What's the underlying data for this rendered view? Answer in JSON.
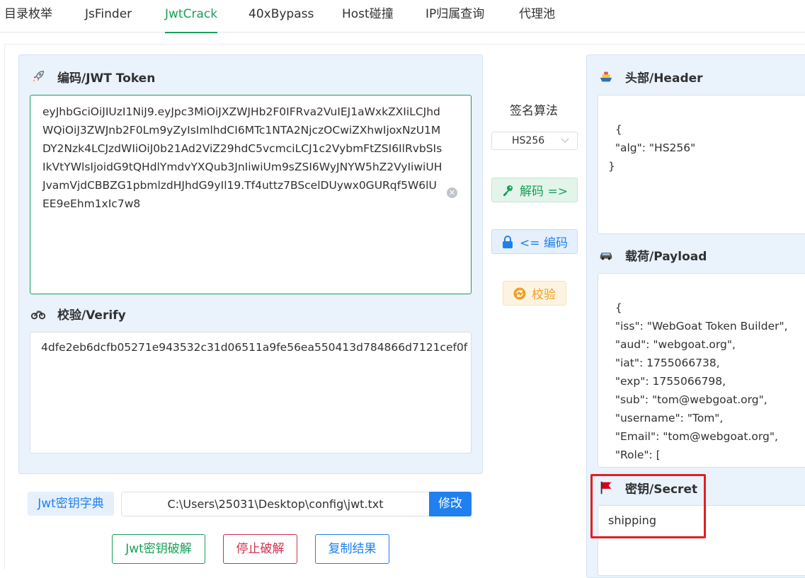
{
  "tabs": [
    {
      "label": "目录枚举"
    },
    {
      "label": "JsFinder"
    },
    {
      "label": "JwtCrack"
    },
    {
      "label": "40xBypass"
    },
    {
      "label": "Host碰撞"
    },
    {
      "label": "IP归属查询"
    },
    {
      "label": "代理池"
    }
  ],
  "active_tab": "JwtCrack",
  "encode_panel": {
    "title": "编码/JWT Token",
    "icon": "rocket-icon",
    "token": "eyJhbGciOiJIUzI1NiJ9.eyJpc3MiOiJXZWJHb2F0IFRva2VuIEJ1aWxkZXIiLCJhdWQiOiJ3ZWJnb2F0Lm9yZyIsImlhdCI6MTc1NTA2NjczOCwiZXhwIjoxNzU1MDY2Nzk4LCJzdWIiOiJ0b21Ad2ViZ29hdC5vcmciLCJ1c2VybmFtZSI6IlRvbSIsIkVtYWlsIjoidG9tQHdlYmdvYXQub3JnIiwiUm9sZSI6WyJNYW5hZ2VyIiwiUHJvamVjdCBBZG1pbmlzdHJhdG9yIl19.Tf4uttz7BScelDUywx0GURqf5W6lUEE9eEhm1xIc7w8"
  },
  "verify_panel": {
    "title": "校验/Verify",
    "icon": "motorcycle-icon",
    "value": "4dfe2eb6dcfb05271e943532c31d06511a9fe56ea550413d784866d7121cef0f"
  },
  "algorithm": {
    "label": "签名算法",
    "selected": "HS256"
  },
  "actions": {
    "decode_label": "解码 =>",
    "encode_label": "<= 编码",
    "verify_label": "校验"
  },
  "header_panel": {
    "title": "头部/Header",
    "icon": "ship-icon",
    "content": "{\n  \"alg\": \"HS256\"\n}"
  },
  "payload_panel": {
    "title": "载荷/Payload",
    "icon": "car-icon",
    "content": "{\n  \"iss\": \"WebGoat Token Builder\",\n  \"aud\": \"webgoat.org\",\n  \"iat\": 1755066738,\n  \"exp\": 1755066798,\n  \"sub\": \"tom@webgoat.org\",\n  \"username\": \"Tom\",\n  \"Email\": \"tom@webgoat.org\",\n  \"Role\": [\n    \"Manager\",\n    \"Project Administrator\"\n  ]\n}"
  },
  "secret_panel": {
    "title": "密钥/Secret",
    "icon": "flag-icon",
    "value": "shipping"
  },
  "dictionary": {
    "tag": "Jwt密钥字典",
    "path": "C:\\Users\\25031\\Desktop\\config\\jwt.txt",
    "modify_label": "修改"
  },
  "bottom_buttons": {
    "crack": "Jwt密钥破解",
    "stop": "停止破解",
    "copy": "复制结果"
  },
  "colors": {
    "green": "#18a058",
    "blue": "#2080f0",
    "orange": "#f0a020",
    "red": "#d03050",
    "highlight": "#e02020"
  }
}
